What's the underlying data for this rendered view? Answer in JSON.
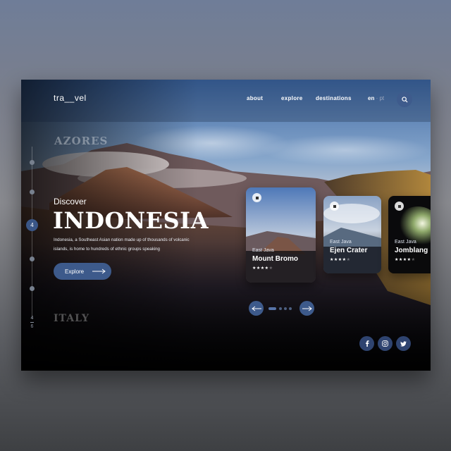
{
  "header": {
    "logo": "tra__vel",
    "nav": [
      "about",
      "explore",
      "destinations"
    ],
    "lang_active": "en",
    "lang_separator": "·",
    "lang_other": "pt"
  },
  "side": {
    "active": "4",
    "count_current": "4",
    "count_total": "6"
  },
  "hero": {
    "prev_destination": "AZORES",
    "eyebrow": "Discover",
    "title": "INDONESIA",
    "description": "Indonesia, a Southeast Asian nation made up of thousands of volcanic islands, is home to hundreds of ethnic groups speaking",
    "cta": "Explore",
    "next_destination": "ITALY"
  },
  "cards": [
    {
      "region": "East Java",
      "title": "Mount Bromo",
      "rating": 4,
      "stars": "★★★★★"
    },
    {
      "region": "East Java",
      "title": "Ejen Crater",
      "rating": 4,
      "stars": "★★★★★"
    },
    {
      "region": "East Java",
      "title": "Jomblang",
      "rating": 4,
      "stars": "★★★★★"
    }
  ],
  "social": [
    "facebook-icon",
    "instagram-icon",
    "twitter-icon"
  ],
  "colors": {
    "accent": "#3d5a8b",
    "accent_dark": "#2f4470",
    "text": "#ffffff"
  }
}
